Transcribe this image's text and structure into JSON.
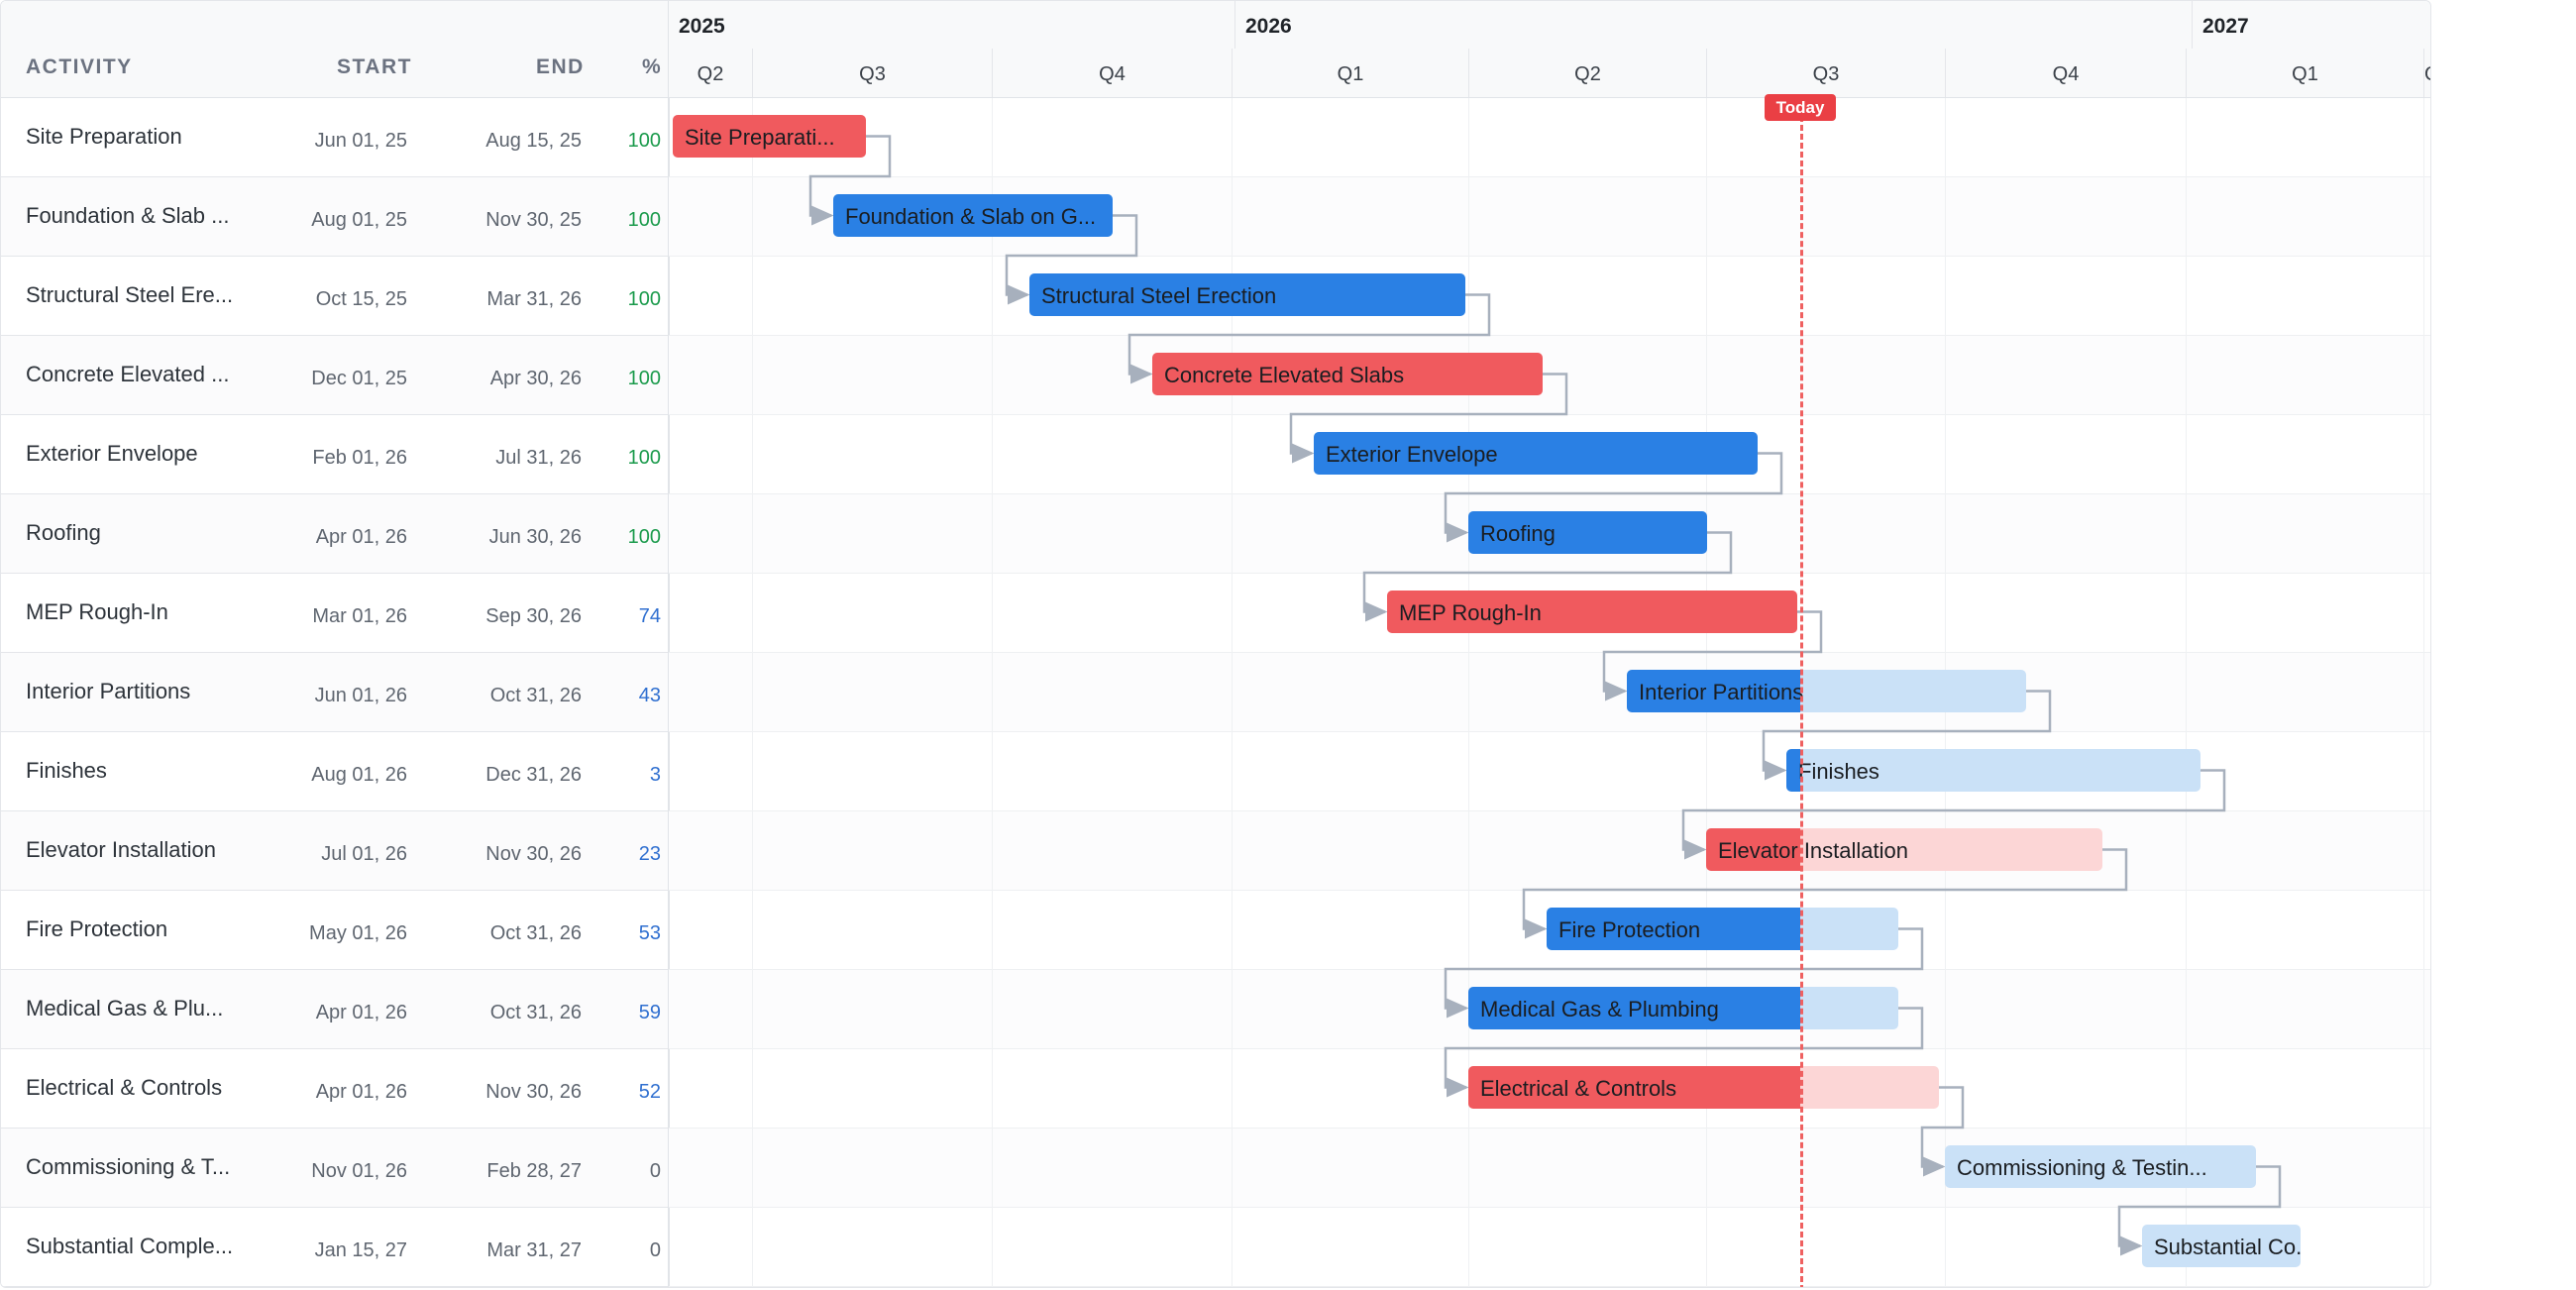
{
  "columns": {
    "activity": "ACTIVITY",
    "start": "START",
    "end": "END",
    "pct": "%"
  },
  "timeline": {
    "years": [
      "2025",
      "2026",
      "2027"
    ],
    "quarters": [
      "Q2",
      "Q3",
      "Q4",
      "Q1",
      "Q2",
      "Q3",
      "Q4",
      "Q1",
      "Q"
    ],
    "today_label": "Today"
  },
  "colors": {
    "critical": "#f05a5e",
    "normal": "#2a80e4",
    "today": "#ea3f44",
    "done_pct": "#1a9a4b",
    "active_pct": "#2f6fd0",
    "zero_pct": "#5f6670"
  },
  "tasks": [
    {
      "name": "Site Preparation",
      "start": "Jun 01, 25",
      "end": "Aug 15, 25",
      "pct": "100",
      "bar_label": "Site Preparati...",
      "critical": true
    },
    {
      "name": "Foundation & Slab ...",
      "start": "Aug 01, 25",
      "end": "Nov 30, 25",
      "pct": "100",
      "bar_label": "Foundation & Slab on G...",
      "critical": false
    },
    {
      "name": "Structural Steel Ere...",
      "start": "Oct 15, 25",
      "end": "Mar 31, 26",
      "pct": "100",
      "bar_label": "Structural Steel Erection",
      "critical": false
    },
    {
      "name": "Concrete Elevated ...",
      "start": "Dec 01, 25",
      "end": "Apr 30, 26",
      "pct": "100",
      "bar_label": "Concrete Elevated Slabs",
      "critical": true
    },
    {
      "name": "Exterior Envelope",
      "start": "Feb 01, 26",
      "end": "Jul 31, 26",
      "pct": "100",
      "bar_label": "Exterior Envelope",
      "critical": false
    },
    {
      "name": "Roofing",
      "start": "Apr 01, 26",
      "end": "Jun 30, 26",
      "pct": "100",
      "bar_label": "Roofing",
      "critical": false
    },
    {
      "name": "MEP Rough-In",
      "start": "Mar 01, 26",
      "end": "Sep 30, 26",
      "pct": "74",
      "bar_label": "MEP Rough-In",
      "critical": true
    },
    {
      "name": "Interior Partitions",
      "start": "Jun 01, 26",
      "end": "Oct 31, 26",
      "pct": "43",
      "bar_label": "Interior Partitions",
      "critical": false
    },
    {
      "name": "Finishes",
      "start": "Aug 01, 26",
      "end": "Dec 31, 26",
      "pct": "3",
      "bar_label": "Finishes",
      "critical": false
    },
    {
      "name": "Elevator Installation",
      "start": "Jul 01, 26",
      "end": "Nov 30, 26",
      "pct": "23",
      "bar_label": "Elevator Installation",
      "critical": true
    },
    {
      "name": "Fire Protection",
      "start": "May 01, 26",
      "end": "Oct 31, 26",
      "pct": "53",
      "bar_label": "Fire Protection",
      "critical": false
    },
    {
      "name": "Medical Gas & Plu...",
      "start": "Apr 01, 26",
      "end": "Oct 31, 26",
      "pct": "59",
      "bar_label": "Medical Gas & Plumbing",
      "critical": false
    },
    {
      "name": "Electrical & Controls",
      "start": "Apr 01, 26",
      "end": "Nov 30, 26",
      "pct": "52",
      "bar_label": "Electrical & Controls",
      "critical": true
    },
    {
      "name": "Commissioning & T...",
      "start": "Nov 01, 26",
      "end": "Feb 28, 27",
      "pct": "0",
      "bar_label": "Commissioning & Testin...",
      "critical": false
    },
    {
      "name": "Substantial Comple...",
      "start": "Jan 15, 27",
      "end": "Mar 31, 27",
      "pct": "0",
      "bar_label": "Substantial Co...",
      "critical": false
    }
  ]
}
